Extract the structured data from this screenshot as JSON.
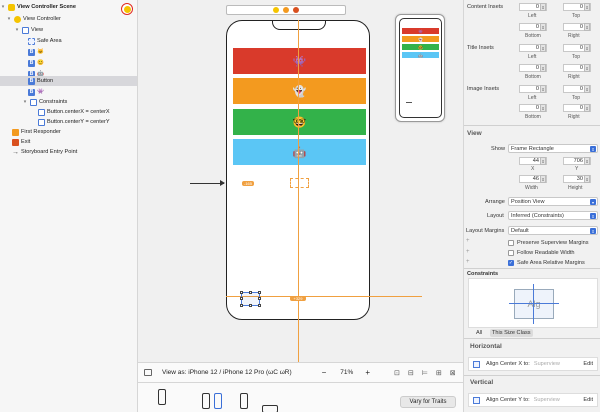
{
  "outline": {
    "items": [
      {
        "label": "View Controller Scene",
        "level": 0,
        "icon": "scene-icon",
        "expanded": true
      },
      {
        "label": "View Controller",
        "level": 1,
        "icon": "view-controller-icon",
        "expanded": true
      },
      {
        "label": "View",
        "level": 2,
        "icon": "view-icon",
        "expanded": true
      },
      {
        "label": "Safe Area",
        "level": 3,
        "icon": "safe-area-icon"
      },
      {
        "label": "🐱",
        "level": 3,
        "icon": "button-icon"
      },
      {
        "label": "😊",
        "level": 3,
        "icon": "button-icon"
      },
      {
        "label": "🤖",
        "level": 3,
        "icon": "button-icon"
      },
      {
        "label": "Button",
        "level": 3,
        "icon": "button-icon",
        "selected": true
      },
      {
        "label": "👾",
        "level": 3,
        "icon": "button-icon"
      },
      {
        "label": "Constraints",
        "level": 3,
        "icon": "constraints-icon",
        "expanded": true
      },
      {
        "label": "Button.centerX = centerX",
        "level": 4,
        "icon": "constraint-icon"
      },
      {
        "label": "Button.centerY = centerY",
        "level": 4,
        "icon": "constraint-icon"
      },
      {
        "label": "First Responder",
        "level": 1,
        "icon": "first-responder-icon"
      },
      {
        "label": "Exit",
        "level": 1,
        "icon": "exit-icon"
      },
      {
        "label": "Storyboard Entry Point",
        "level": 1,
        "icon": "entry-point-icon"
      }
    ]
  },
  "canvas": {
    "strips": [
      {
        "emoji": "👾",
        "color": "#d93a2b"
      },
      {
        "emoji": "👻",
        "color": "#f39a1f"
      },
      {
        "emoji": "🤓",
        "color": "#33b24a"
      },
      {
        "emoji": "🤖",
        "color": "#5bc6f5"
      }
    ],
    "center_x_badge": "-165",
    "center_y_badge": "+329",
    "selected_button_label": "Button"
  },
  "bottombar": {
    "view_as": "View as: iPhone 12 / iPhone 12 Pro (ωC ωR)",
    "zoom_level": "71%",
    "zoom_out": "−",
    "zoom_in": "+",
    "vary_for_traits": "Vary for Traits"
  },
  "inspector": {
    "content_insets": {
      "label": "Content Insets",
      "top": "0",
      "left": "0",
      "bottom": "0",
      "right": "0"
    },
    "title_insets": {
      "label": "Title Insets",
      "top": "0",
      "left": "0",
      "bottom": "0",
      "right": "0"
    },
    "image_insets": {
      "label": "Image Insets",
      "top": "0",
      "left": "0",
      "bottom": "0",
      "right": "0"
    },
    "sub_labels": {
      "left": "Left",
      "top": "Top",
      "bottom": "Bottom",
      "right": "Right",
      "x": "X",
      "y": "Y",
      "width": "Width",
      "height": "Height"
    },
    "view_header": "View",
    "show_label": "Show",
    "show_value": "Frame Rectangle",
    "frame": {
      "x": "44",
      "y": "706",
      "width": "46",
      "height": "30"
    },
    "arrange_label": "Arrange",
    "arrange_value": "Position View",
    "layout_label": "Layout",
    "layout_value": "Inferred (Constraints)",
    "layout_margins_label": "Layout Margins",
    "layout_margins_value": "Default",
    "preserve_superview": "Preserve Superview Margins",
    "follow_readable": "Follow Readable Width",
    "safe_area_relative": "Safe Area Relative Margins",
    "constraints_header": "Constraints",
    "constraints_tab_all": "All",
    "constraints_tab_size": "This Size Class",
    "horizontal_header": "Horizontal",
    "align_center_x": "Align Center X to:",
    "vertical_header": "Vertical",
    "align_center_y": "Align Center Y to:",
    "superview": "Superview",
    "edit": "Edit"
  }
}
